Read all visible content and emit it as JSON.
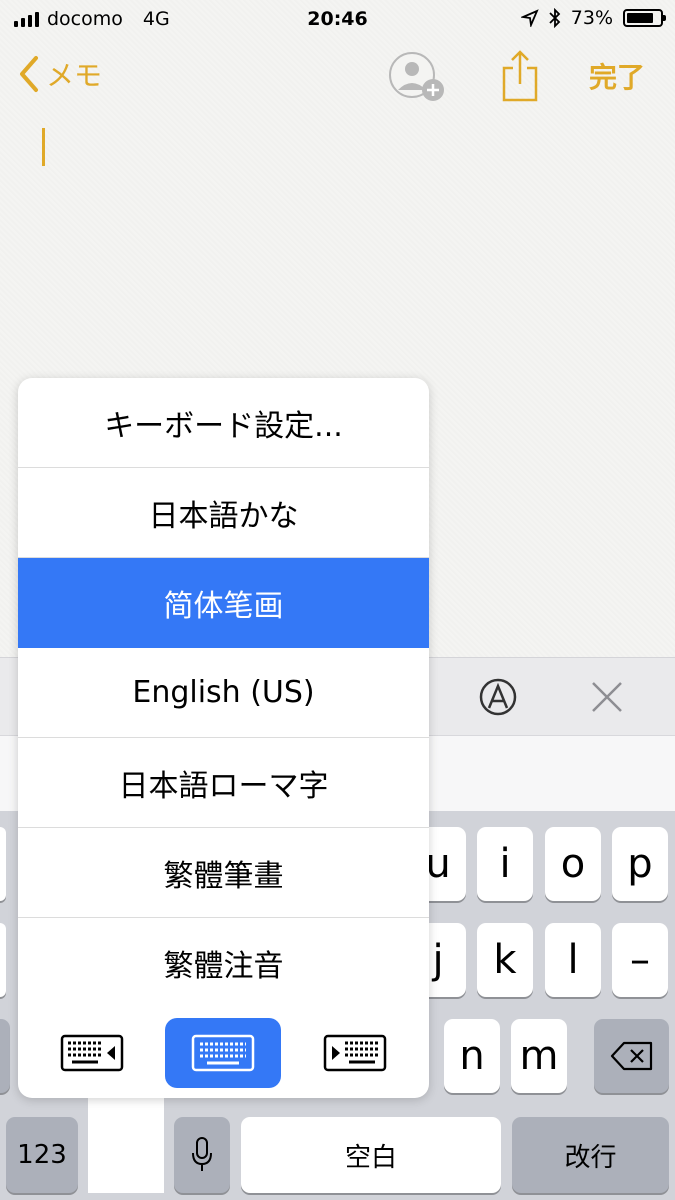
{
  "status_bar": {
    "carrier": "docomo",
    "network": "4G",
    "time": "20:46",
    "battery_percent": "73%",
    "battery_level": 0.73
  },
  "nav": {
    "back_label": "メモ",
    "done_label": "完了",
    "accent_color": "#e0a928"
  },
  "keyboard_menu": {
    "items": [
      {
        "label": "キーボード設定...",
        "selected": false
      },
      {
        "label": "日本語かな",
        "selected": false
      },
      {
        "label": "简体笔画",
        "selected": true
      },
      {
        "label": "English (US)",
        "selected": false
      },
      {
        "label": "日本語ローマ字",
        "selected": false
      },
      {
        "label": "繁體筆畫",
        "selected": false
      },
      {
        "label": "繁體注音",
        "selected": false
      }
    ],
    "selection_color": "#3478f6",
    "layout_buttons": [
      "keyboard-left-icon",
      "keyboard-full-icon",
      "keyboard-right-icon"
    ]
  },
  "keyboard": {
    "row1": [
      "u",
      "i",
      "o",
      "p"
    ],
    "row2": [
      "j",
      "k",
      "l",
      "–"
    ],
    "row3": [
      "n",
      "m"
    ],
    "numbers_label": "123",
    "space_label": "空白",
    "return_label": "改行"
  }
}
